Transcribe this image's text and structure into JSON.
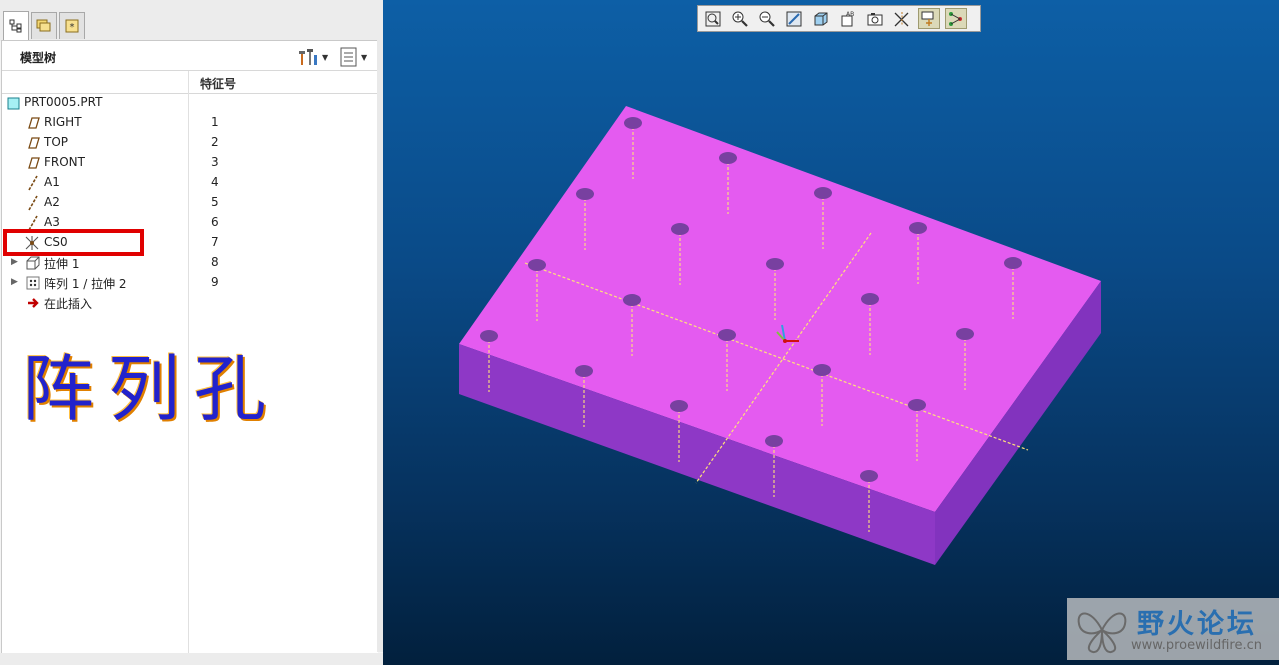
{
  "tabs": [
    {
      "name": "model-tree-tab",
      "icon": "tree-icon",
      "active": true
    },
    {
      "name": "folder-browser-tab",
      "icon": "folders-icon",
      "active": false
    },
    {
      "name": "favorites-tab",
      "icon": "star-icon",
      "active": false
    }
  ],
  "tree": {
    "title": "模型树",
    "column_feature": "特征号",
    "rows": [
      {
        "label": "PRT0005.PRT",
        "num": "",
        "icon": "part-icon",
        "expander": false
      },
      {
        "label": "RIGHT",
        "num": "1",
        "icon": "datum-plane-icon",
        "expander": false
      },
      {
        "label": "TOP",
        "num": "2",
        "icon": "datum-plane-icon",
        "expander": false
      },
      {
        "label": "FRONT",
        "num": "3",
        "icon": "datum-plane-icon",
        "expander": false
      },
      {
        "label": "A1",
        "num": "4",
        "icon": "datum-axis-icon",
        "expander": false
      },
      {
        "label": "A2",
        "num": "5",
        "icon": "datum-axis-icon",
        "expander": false
      },
      {
        "label": "A3",
        "num": "6",
        "icon": "datum-axis-icon",
        "expander": false
      },
      {
        "label": "CS0",
        "num": "7",
        "icon": "coordinate-system-icon",
        "expander": false
      },
      {
        "label": "拉伸 1",
        "num": "8",
        "icon": "extrude-icon",
        "expander": true
      },
      {
        "label": "阵列 1 / 拉伸 2",
        "num": "9",
        "icon": "pattern-icon",
        "expander": true
      },
      {
        "label": "在此插入",
        "num": "",
        "icon": "insert-here-arrow-icon",
        "expander": false
      }
    ]
  },
  "annotation": "阵列孔",
  "toolbar": {
    "buttons": [
      "refit-icon",
      "zoom-in-icon",
      "zoom-out-icon",
      "repaint-icon",
      "shading-icon",
      "saved-views-icon",
      "view-manager-icon",
      "datum-display-icon",
      "spin-center-icon",
      "annotation-display-icon"
    ]
  },
  "watermark": {
    "title": "野火论坛",
    "url": "www.proewildfire.cn"
  },
  "colors": {
    "part_top": "#e45bf0",
    "part_front": "#8e38c6",
    "part_side": "#8233be",
    "hole": "#7840a0",
    "axis_line": "#ffe27a",
    "viewport_top": "#0d5fa6",
    "viewport_bottom": "#02203d",
    "highlight": "#e00000"
  }
}
